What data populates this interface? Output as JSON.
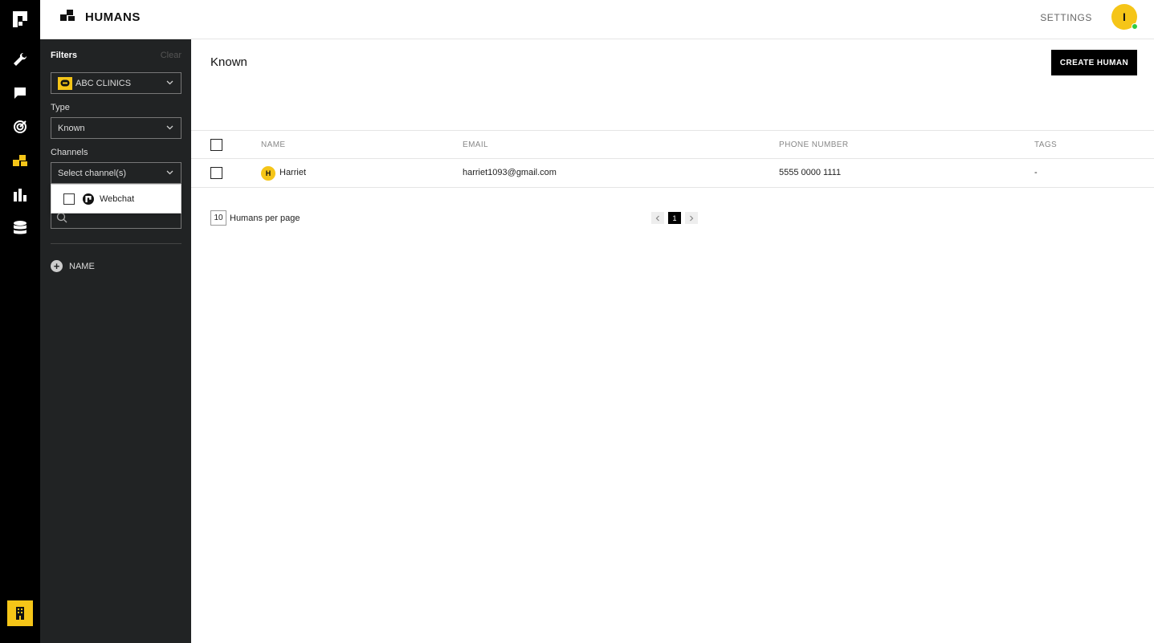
{
  "header": {
    "title": "HUMANS",
    "settings_label": "SETTINGS",
    "avatar_initial": "I"
  },
  "nav": {
    "items": [
      "logo-icon",
      "wrench-icon",
      "chat-icon",
      "target-icon",
      "humans-icon",
      "chart-icon",
      "database-icon"
    ],
    "bottom": "building-icon"
  },
  "filters": {
    "title": "Filters",
    "clear_label": "Clear",
    "organization": "ABC CLINICS",
    "type_label": "Type",
    "type_value": "Known",
    "channels_label": "Channels",
    "channels_placeholder": "Select channel(s)",
    "channel_options": [
      "Webchat"
    ],
    "add_filter_label": "NAME"
  },
  "main": {
    "title": "Known",
    "create_label": "CREATE HUMAN",
    "columns": {
      "name": "NAME",
      "email": "EMAIL",
      "phone": "PHONE NUMBER",
      "tags": "TAGS"
    },
    "rows": [
      {
        "initial": "H",
        "name": "Harriet",
        "email": "harriet1093@gmail.com",
        "phone": "5555 0000 1111",
        "tags": "-"
      }
    ],
    "per_page_value": "10",
    "per_page_label": "Humans per page",
    "current_page": "1"
  },
  "colors": {
    "accent": "#f5c518",
    "sidebar": "#000000",
    "filter_panel": "#212324",
    "online": "#2ecc40"
  }
}
